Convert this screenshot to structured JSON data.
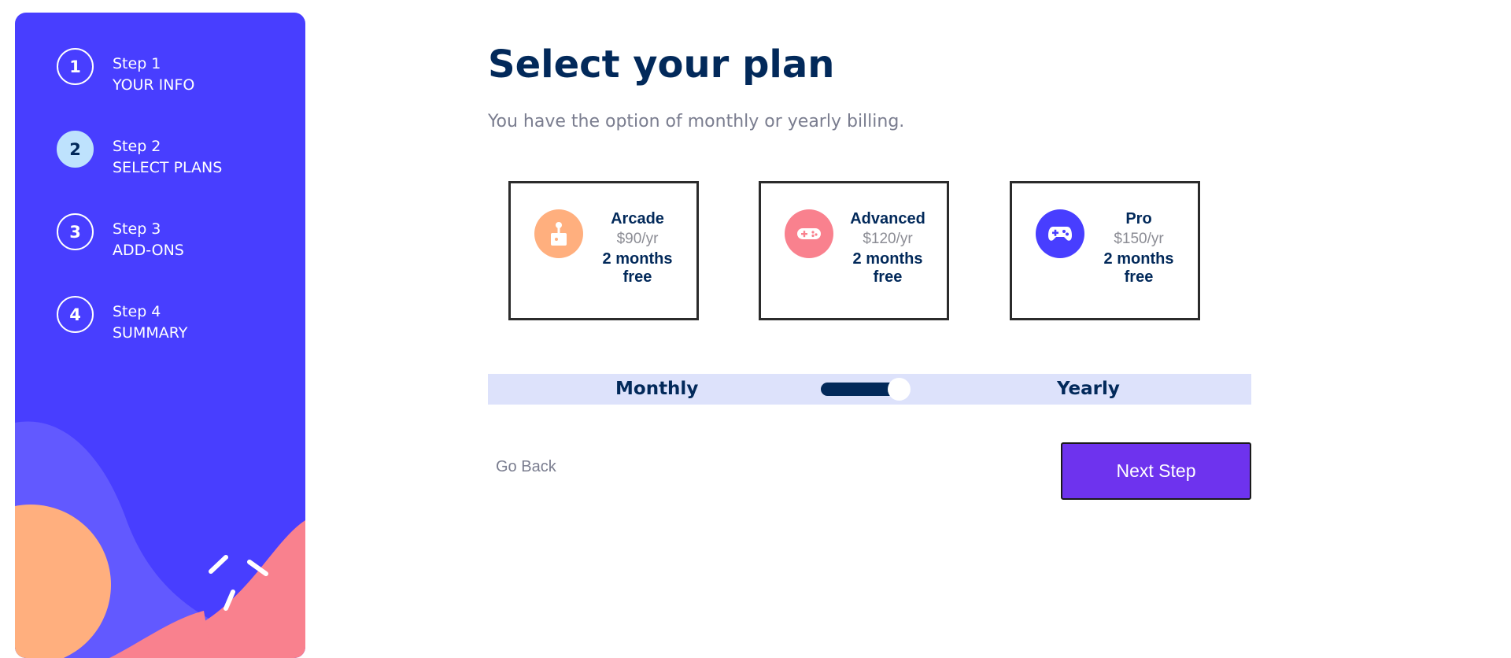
{
  "steps": [
    {
      "number": "1",
      "label": "Step 1",
      "name": "YOUR INFO",
      "active": false
    },
    {
      "number": "2",
      "label": "Step 2",
      "name": "SELECT PLANS",
      "active": true
    },
    {
      "number": "3",
      "label": "Step 3",
      "name": "ADD-ONS",
      "active": false
    },
    {
      "number": "4",
      "label": "Step 4",
      "name": "SUMMARY",
      "active": false
    }
  ],
  "main": {
    "title": "Select your plan",
    "subtitle": "You have the option of monthly or yearly billing."
  },
  "plans": [
    {
      "name": "Arcade",
      "price": "$90/yr",
      "promo": "2 months free",
      "icon": "joystick-icon",
      "color": "#ffaf7e"
    },
    {
      "name": "Advanced",
      "price": "$120/yr",
      "promo": "2 months free",
      "icon": "gamepad-icon",
      "color": "#f9818e"
    },
    {
      "name": "Pro",
      "price": "$150/yr",
      "promo": "2 months free",
      "icon": "controller-icon",
      "color": "#483eff"
    }
  ],
  "billing": {
    "monthly_label": "Monthly",
    "yearly_label": "Yearly",
    "selected": "yearly"
  },
  "nav": {
    "back_label": "Go Back",
    "next_label": "Next Step"
  },
  "colors": {
    "sidebar": "#483eff",
    "accent": "#6e33ee",
    "marine": "#02295a",
    "active_step": "#bee2fd"
  }
}
